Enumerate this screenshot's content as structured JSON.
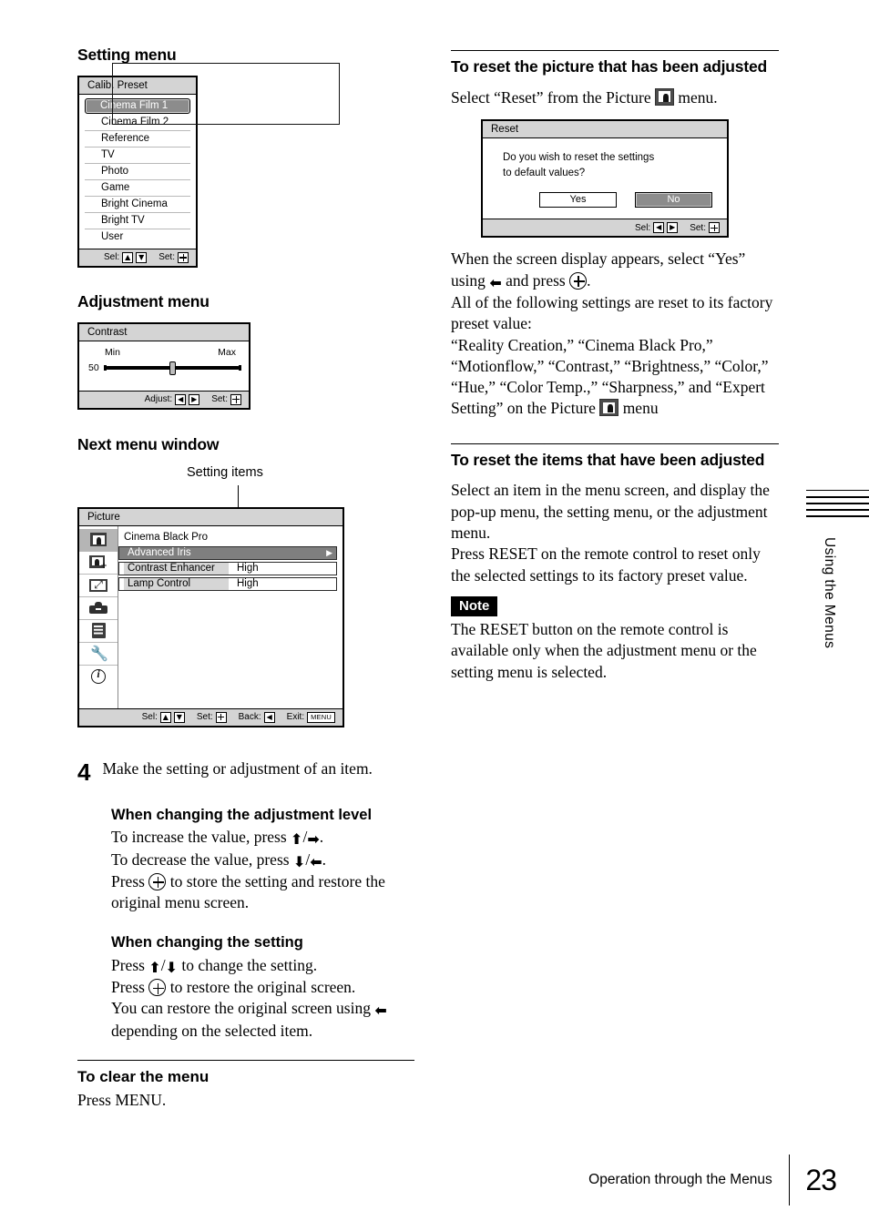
{
  "left_column": {
    "setting_menu": {
      "heading": "Setting menu",
      "osd": {
        "title": "Calib. Preset",
        "items": [
          "Cinema Film 1",
          "Cinema Film 2",
          "Reference",
          "TV",
          "Photo",
          "Game",
          "Bright Cinema",
          "Bright TV",
          "User"
        ],
        "selected_index": 0,
        "footer": {
          "sel_label": "Sel:",
          "set_label": "Set:"
        }
      }
    },
    "adjustment_menu": {
      "heading": "Adjustment menu",
      "osd": {
        "title": "Contrast",
        "min_label": "Min",
        "max_label": "Max",
        "value": "50",
        "footer": {
          "adjust_label": "Adjust:",
          "set_label": "Set:"
        }
      }
    },
    "next_menu_window": {
      "heading": "Next menu window",
      "callout": "Setting items",
      "osd": {
        "title": "Picture",
        "rows": [
          {
            "label": "Cinema Black Pro",
            "value": "",
            "style": "plain"
          },
          {
            "label": "Advanced Iris",
            "value": "",
            "style": "selected",
            "caret": "▶"
          },
          {
            "label": "Contrast Enhancer",
            "value": "High",
            "style": "box"
          },
          {
            "label": "Lamp Control",
            "value": "High",
            "style": "box"
          }
        ],
        "rail_icons": [
          "picture-icon",
          "picture-plus-icon",
          "screen-icon",
          "toolbox-icon",
          "list-icon",
          "wrench-icon",
          "info-icon"
        ],
        "footer": {
          "sel_label": "Sel:",
          "set_label": "Set:",
          "back_label": "Back:",
          "exit_label": "Exit:",
          "exit_key": "MENU"
        }
      }
    },
    "step4": {
      "number": "4",
      "text": "Make the setting or adjustment of an item."
    },
    "changing_level": {
      "heading": "When changing the adjustment level",
      "line1_a": "To increase the value, press ",
      "line1_b": "/",
      "line1_c": ".",
      "line2_a": "To decrease the value, press ",
      "line2_b": "/",
      "line2_c": ".",
      "line3_a": "Press ",
      "line3_b": " to store the setting and restore the original menu screen."
    },
    "changing_setting": {
      "heading": "When changing the setting",
      "line1_a": "Press ",
      "line1_b": "/",
      "line1_c": " to change the setting.",
      "line2_a": "Press ",
      "line2_b": " to restore the original screen.",
      "line3_a": "You can restore the original screen using ",
      "line3_b": " depending on the selected item."
    },
    "clear_menu": {
      "heading": "To clear the menu",
      "text": "Press MENU."
    }
  },
  "right_column": {
    "reset_picture": {
      "heading": "To reset the picture that has been adjusted",
      "intro_a": "Select “Reset” from the Picture ",
      "intro_b": " menu.",
      "dialog": {
        "title": "Reset",
        "message_line1": "Do you wish to reset the settings",
        "message_line2": "to default values?",
        "yes_label": "Yes",
        "no_label": "No",
        "selected_button": "No",
        "footer": {
          "sel_label": "Sel:",
          "set_label": "Set:"
        }
      },
      "body_1": "When the screen display appears, select “Yes” using ",
      "body_2": " and press ",
      "body_3": ".",
      "body_4": "All of the following settings are reset to its factory preset value:",
      "body_5": "“Reality Creation,” “Cinema Black Pro,” “Motionflow,” “Contrast,” “Brightness,” “Color,” “Hue,” “Color Temp.,” “Sharpness,” and “Expert Setting” on the Picture ",
      "body_6": " menu"
    },
    "reset_items": {
      "heading": "To reset the items that have been adjusted",
      "body_1": "Select an item in the menu screen, and display the pop-up menu, the setting menu, or the adjustment menu.",
      "body_2": "Press RESET on the remote control to reset only the selected settings to its factory preset value.",
      "note_badge": "Note",
      "note_text": "The RESET button on the remote control is available only when the adjustment menu or the setting menu is selected."
    }
  },
  "thumb_tab": {
    "label": "Using the Menus"
  },
  "footer": {
    "section": "Operation through the Menus",
    "page": "23"
  }
}
